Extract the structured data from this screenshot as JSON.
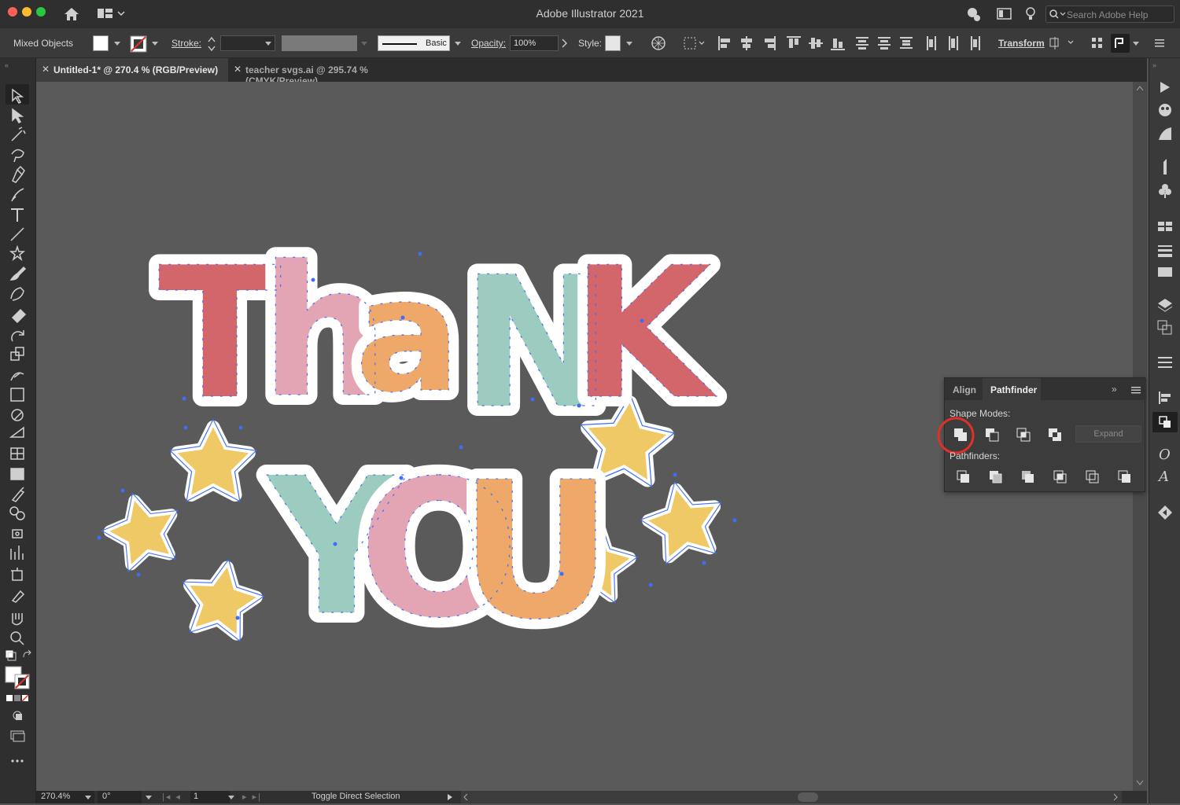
{
  "window": {
    "title": "Adobe Illustrator 2021",
    "search_placeholder": "Search Adobe Help"
  },
  "control_bar": {
    "selection_label": "Mixed Objects",
    "stroke_label": "Stroke:",
    "brush_label": "Basic",
    "opacity_label": "Opacity:",
    "opacity_value": "100%",
    "style_label": "Style:",
    "transform_label": "Transform"
  },
  "tabs": [
    {
      "label": "Untitled-1* @ 270.4 % (RGB/Preview)",
      "active": true
    },
    {
      "label": "teacher svgs.ai @ 295.74 % (CMYK/Preview)",
      "active": false
    }
  ],
  "artwork": {
    "word1": "ThaNK",
    "word2": "YOU"
  },
  "pathfinder_panel": {
    "tab_align": "Align",
    "tab_pathfinder": "Pathfinder",
    "shape_modes_label": "Shape Modes:",
    "expand_label": "Expand",
    "pathfinders_label": "Pathfinders:"
  },
  "status_bar": {
    "zoom": "270.4%",
    "rotation": "0°",
    "artboard": "1",
    "tool_hint": "Toggle Direct Selection"
  },
  "colors": {
    "red": "#d2666b",
    "pink": "#e3a4b4",
    "orange": "#eda86a",
    "teal": "#9ccbbf",
    "star": "#efc965",
    "highlight": "#e0302a",
    "selection": "#3d6ff5"
  }
}
